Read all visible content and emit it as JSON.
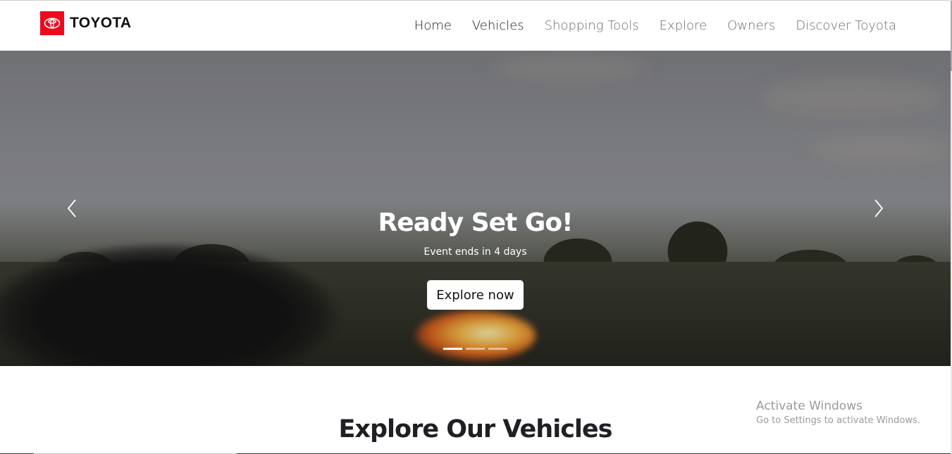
{
  "header": {
    "brand_name": "TOYOTA",
    "brand_icon": "toyota-logo-icon",
    "nav": [
      {
        "label": "Home"
      },
      {
        "label": "Vehicles"
      },
      {
        "label": "Shopping Tools"
      },
      {
        "label": "Explore"
      },
      {
        "label": "Owners"
      },
      {
        "label": "Discover Toyota"
      }
    ]
  },
  "hero": {
    "title": "Ready Set Go!",
    "subtitle": "Event ends in 4 days",
    "cta_label": "Explore now",
    "prev_icon": "chevron-left-icon",
    "next_icon": "chevron-right-icon",
    "slides_count": 3,
    "active_slide": 1
  },
  "section": {
    "title": "Explore Our Vehicles"
  },
  "watermark": {
    "title": "Activate Windows",
    "subtitle": "Go to Settings to activate Windows."
  },
  "colors": {
    "brand_red": "#eb0a1e",
    "nav_active": "#1b1b1b",
    "nav_inactive": "#6a6a6a",
    "heading": "#1f1f24"
  }
}
